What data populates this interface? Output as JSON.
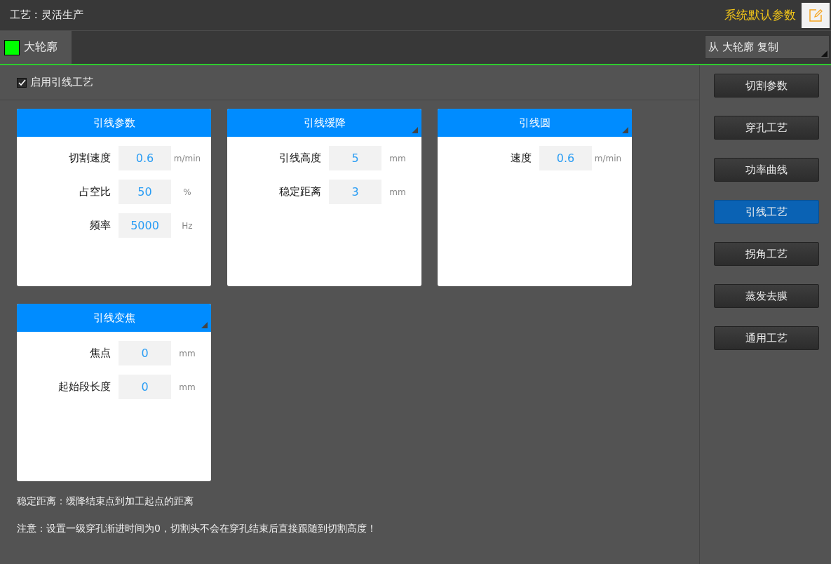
{
  "header": {
    "title": "工艺 : 灵活生产",
    "defaults_label": "系统默认参数"
  },
  "tabs": [
    {
      "label": "大轮廓",
      "color": "#00ff00",
      "selected": true
    }
  ],
  "copy_dropdown": {
    "value": "从 大轮廓 复制"
  },
  "enable_checkbox": {
    "label": "启用引线工艺",
    "checked": true
  },
  "panels": [
    {
      "title": "引线参数",
      "has_menu": false,
      "fields": [
        {
          "label": "切割速度",
          "value": "0.6",
          "unit": "m/min"
        },
        {
          "label": "占空比",
          "value": "50",
          "unit": "%"
        },
        {
          "label": "频率",
          "value": "5000",
          "unit": "Hz"
        }
      ]
    },
    {
      "title": "引线缓降",
      "has_menu": true,
      "fields": [
        {
          "label": "引线高度",
          "value": "5",
          "unit": "mm"
        },
        {
          "label": "稳定距离",
          "value": "3",
          "unit": "mm"
        }
      ]
    },
    {
      "title": "引线圆",
      "has_menu": true,
      "fields": [
        {
          "label": "速度",
          "value": "0.6",
          "unit": "m/min"
        }
      ]
    },
    {
      "title": "引线变焦",
      "has_menu": true,
      "fields": [
        {
          "label": "焦点",
          "value": "0",
          "unit": "mm"
        },
        {
          "label": "起始段长度",
          "value": "0",
          "unit": "mm"
        }
      ]
    }
  ],
  "notes": [
    "稳定距离：缓降结束点到加工起点的距离",
    "注意：设置一级穿孔渐进时间为0，切割头不会在穿孔结束后直接跟随到切割高度！"
  ],
  "sidebar": [
    {
      "label": "切割参数",
      "selected": false
    },
    {
      "label": "穿孔工艺",
      "selected": false
    },
    {
      "label": "功率曲线",
      "selected": false
    },
    {
      "label": "引线工艺",
      "selected": true
    },
    {
      "label": "拐角工艺",
      "selected": false
    },
    {
      "label": "蒸发去膜",
      "selected": false
    },
    {
      "label": "通用工艺",
      "selected": false
    }
  ]
}
